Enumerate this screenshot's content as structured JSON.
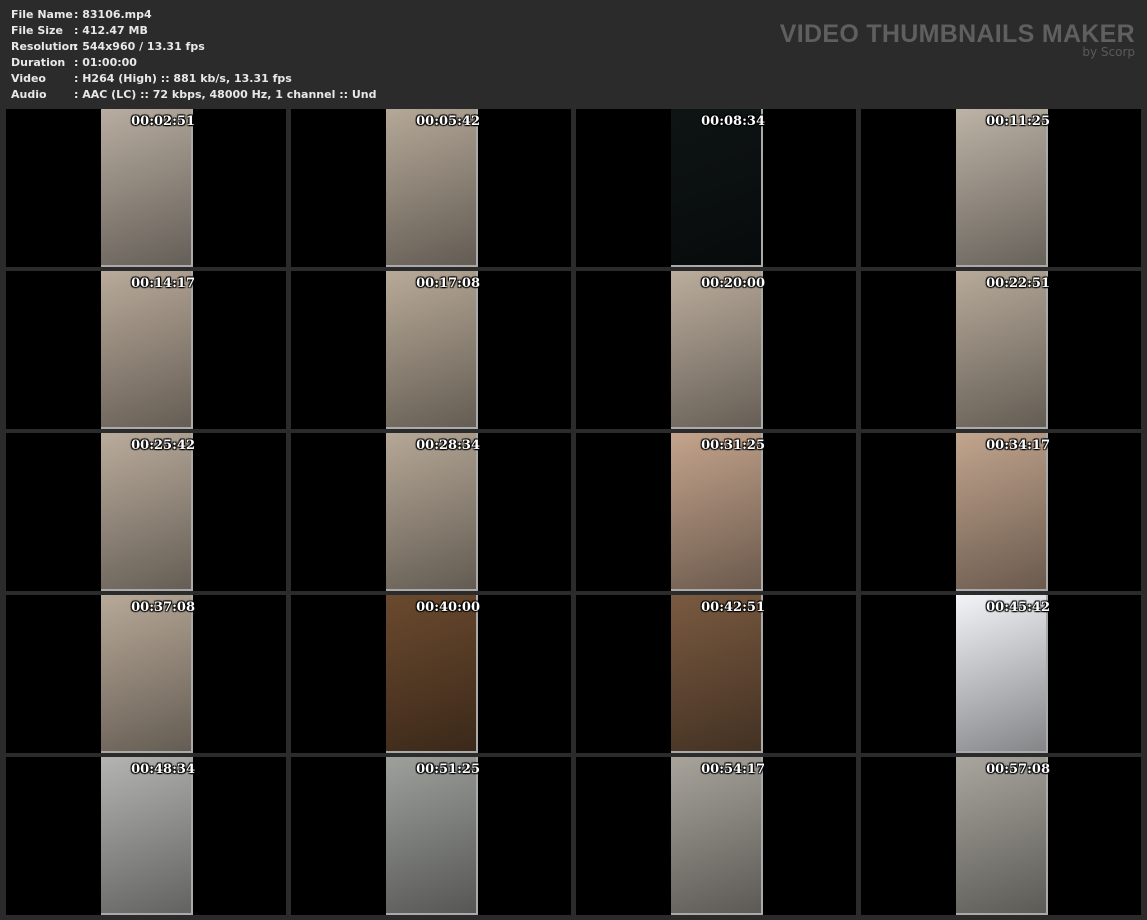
{
  "info": [
    {
      "key": "File Name",
      "value": ": 83106.mp4"
    },
    {
      "key": "File Size",
      "value": ": 412.47 MB"
    },
    {
      "key": "Resolution",
      "value": ": 544x960 / 13.31 fps"
    },
    {
      "key": "Duration",
      "value": ": 01:00:00"
    },
    {
      "key": "Video",
      "value": ": H264 (High) :: 881 kb/s, 13.31 fps"
    },
    {
      "key": "Audio",
      "value": ": AAC (LC) :: 72 kbps, 48000 Hz, 1 channel :: Und"
    }
  ],
  "brand": {
    "title": "VIDEO THUMBNAILS MAKER",
    "subtitle": "by Scorp"
  },
  "thumbnails": [
    {
      "time": "00:02:51",
      "tone": "#b8ada0"
    },
    {
      "time": "00:05:42",
      "tone": "#b5a898"
    },
    {
      "time": "00:08:34",
      "tone": "#0e1414"
    },
    {
      "time": "00:11:25",
      "tone": "#bdb3a6"
    },
    {
      "time": "00:14:17",
      "tone": "#b9aa9a"
    },
    {
      "time": "00:17:08",
      "tone": "#b8aa98"
    },
    {
      "time": "00:20:00",
      "tone": "#bbad9d"
    },
    {
      "time": "00:22:51",
      "tone": "#b7aa9a"
    },
    {
      "time": "00:25:42",
      "tone": "#baac9c"
    },
    {
      "time": "00:28:34",
      "tone": "#b6a897"
    },
    {
      "time": "00:31:25",
      "tone": "#c4a48c"
    },
    {
      "time": "00:34:17",
      "tone": "#c2a58e"
    },
    {
      "time": "00:37:08",
      "tone": "#b8a998"
    },
    {
      "time": "00:40:00",
      "tone": "#6b4a2e"
    },
    {
      "time": "00:42:51",
      "tone": "#7a5a40"
    },
    {
      "time": "00:45:42",
      "tone": "#f2f4f8"
    },
    {
      "time": "00:48:34",
      "tone": "#b4b4b2"
    },
    {
      "time": "00:51:25",
      "tone": "#9ea09c"
    },
    {
      "time": "00:54:17",
      "tone": "#a8a49c"
    },
    {
      "time": "00:57:08",
      "tone": "#a9a69e"
    }
  ]
}
